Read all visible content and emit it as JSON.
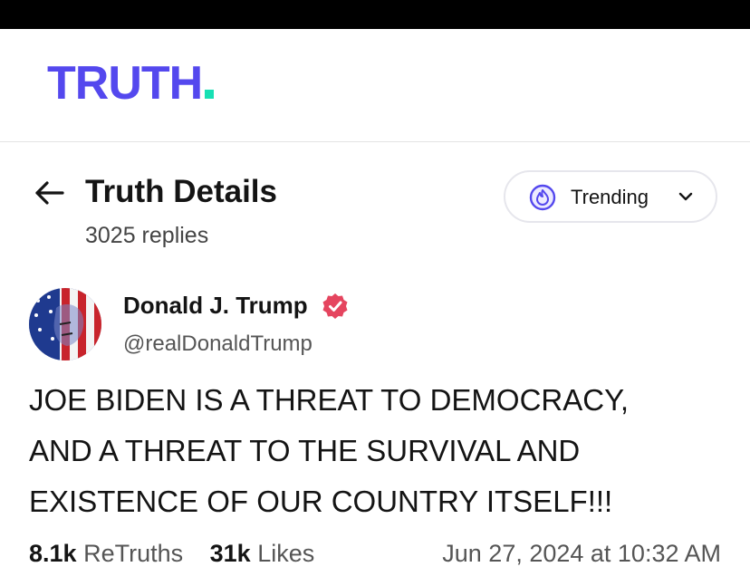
{
  "app": {
    "logo_text": "TRUTH",
    "accent_color": "#5448ee",
    "dot_color": "#17e0b4"
  },
  "page": {
    "title": "Truth Details",
    "replies": "3025 replies"
  },
  "filter": {
    "label": "Trending",
    "icon": "flame-icon"
  },
  "author": {
    "name": "Donald J. Trump",
    "handle": "@realDonaldTrump",
    "verified_color": "#e5455f"
  },
  "post": {
    "lines": [
      "JOE BIDEN IS A THREAT TO DEMOCRACY,",
      "AND A THREAT TO THE SURVIVAL AND",
      "EXISTENCE OF OUR COUNTRY ITSELF!!!"
    ]
  },
  "stats": {
    "retruths_count": "8.1k",
    "retruths_label": "ReTruths",
    "likes_count": "31k",
    "likes_label": "Likes",
    "timestamp": "Jun 27, 2024 at 10:32 AM"
  }
}
